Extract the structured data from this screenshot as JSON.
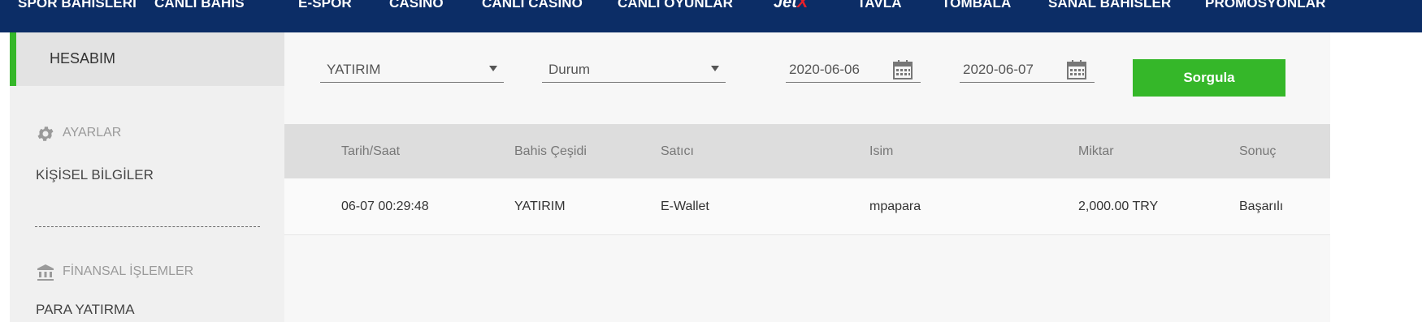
{
  "topnav": {
    "items": [
      "SPOR BAHİSLERİ",
      "CANLI BAHİS",
      "E-SPOR",
      "CASINO",
      "CANLI CASINO",
      "CANLI OYUNLAR",
      "TAVLA",
      "TOMBALA",
      "SANAL BAHİSLER",
      "PROMOSYONLAR"
    ],
    "jetx": {
      "main": "Jet",
      "x": "X"
    }
  },
  "sidebar": {
    "header": "HESABIM",
    "settings_title": "AYARLAR",
    "personal_info": "KİŞİSEL BİLGİLER",
    "finance_title": "FİNANSAL İŞLEMLER",
    "deposit": "PARA YATIRMA"
  },
  "filters": {
    "type": "YATIRIM",
    "status": "Durum",
    "date_from": "2020-06-06",
    "date_to": "2020-06-07",
    "query_button": "Sorgula"
  },
  "table": {
    "columns": [
      "Tarih/Saat",
      "Bahis Çeşidi",
      "Satıcı",
      "Isim",
      "Miktar",
      "Sonuç"
    ],
    "rows": [
      [
        "06-07 00:29:48",
        "YATIRIM",
        "E-Wallet",
        "mpapara",
        "2,000.00 TRY",
        "Başarılı"
      ]
    ]
  },
  "colors": {
    "nav": "#0c2d66",
    "accent": "#35b729",
    "jetx_x": "#e8202a"
  }
}
